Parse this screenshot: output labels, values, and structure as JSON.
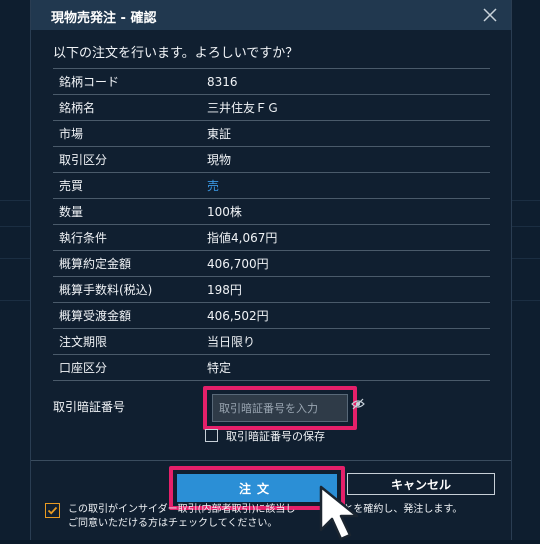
{
  "dialog": {
    "title": "現物売発注 - 確認",
    "prompt": "以下の注文を行います。よろしいですか？",
    "rows": [
      {
        "label": "銘柄コード",
        "value": "8316"
      },
      {
        "label": "銘柄名",
        "value": "三井住友ＦＧ"
      },
      {
        "label": "市場",
        "value": "東証"
      },
      {
        "label": "取引区分",
        "value": "現物"
      },
      {
        "label": "売買",
        "value": "売"
      },
      {
        "label": "数量",
        "value": "100株"
      },
      {
        "label": "執行条件",
        "value": "指値4,067円"
      },
      {
        "label": "概算約定金額",
        "value": "406,700円"
      },
      {
        "label": "概算手数料(税込)",
        "value": "198円"
      },
      {
        "label": "概算受渡金額",
        "value": "406,502円"
      },
      {
        "label": "注文期限",
        "value": "当日限り"
      },
      {
        "label": "口座区分",
        "value": "特定"
      }
    ],
    "pin": {
      "label": "取引暗証番号",
      "placeholder": "取引暗証番号を入力",
      "save_label": "取引暗証番号の保存"
    },
    "buttons": {
      "order": "注文",
      "cancel": "キャンセル"
    },
    "agreement": {
      "line1": "この取引がインサイダー取引(内部者取引)に該当し",
      "line1_end": "ことを確約し、発注します。",
      "line2": "ご同意いただける方はチェックしてください。",
      "checked": true
    }
  },
  "colors": {
    "accent": "#2b8fd6",
    "highlight": "#e5206a",
    "sell": "#3b9ae6",
    "checkbox": "#e89a22"
  }
}
